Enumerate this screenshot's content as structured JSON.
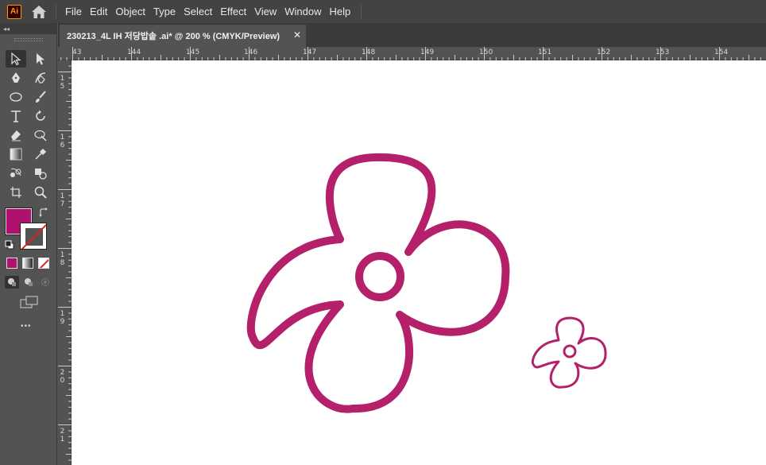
{
  "app": {
    "logo_text": "Ai"
  },
  "menu": {
    "items": [
      "File",
      "Edit",
      "Object",
      "Type",
      "Select",
      "Effect",
      "View",
      "Window",
      "Help"
    ]
  },
  "toolbar": {
    "collapse_glyph": "◂◂",
    "fill_color": "#b0106e",
    "stroke_color": "none",
    "more_tools_glyph": "•••"
  },
  "document": {
    "tab_title": "230213_4L  IH 저당밥솥 .ai* @ 200 % (CMYK/Preview)",
    "close_glyph": "✕"
  },
  "rulers": {
    "horizontal": [
      "43",
      "144",
      "145",
      "146",
      "147",
      "148",
      "149",
      "150",
      "151",
      "152",
      "153",
      "154"
    ],
    "vertical": [
      [
        "1",
        "5"
      ],
      [
        "1",
        "6"
      ],
      [
        "1",
        "7"
      ],
      [
        "1",
        "8"
      ],
      [
        "1",
        "9"
      ],
      [
        "2",
        "0"
      ],
      [
        "2",
        "1"
      ]
    ]
  },
  "artwork": {
    "stroke_color": "#b5206a",
    "shapes": [
      "large-flower",
      "small-flower"
    ]
  }
}
